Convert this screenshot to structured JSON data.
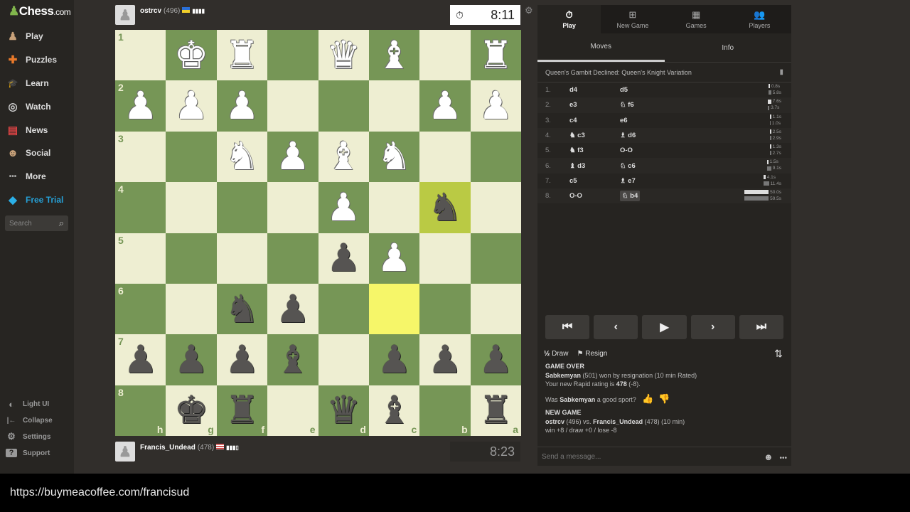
{
  "sidebar": {
    "logo": "Chess",
    "logo_suffix": ".com",
    "items": [
      {
        "label": "Play",
        "icon": "♟"
      },
      {
        "label": "Puzzles",
        "icon": "✚"
      },
      {
        "label": "Learn",
        "icon": "🎓"
      },
      {
        "label": "Watch",
        "icon": "◎"
      },
      {
        "label": "News",
        "icon": "▤"
      },
      {
        "label": "Social",
        "icon": "☻"
      },
      {
        "label": "More",
        "icon": "•••"
      },
      {
        "label": "Free Trial",
        "icon": "◆"
      }
    ],
    "search_placeholder": "Search",
    "bottom": [
      {
        "label": "Light UI",
        "icon": "◐"
      },
      {
        "label": "Collapse",
        "icon": "|←"
      },
      {
        "label": "Settings",
        "icon": "⚙"
      },
      {
        "label": "Support",
        "icon": "?"
      }
    ]
  },
  "top_player": {
    "name": "ostrcv",
    "rating": "(496)",
    "clock": "8:11"
  },
  "bottom_player": {
    "name": "Francis_Undead",
    "rating": "(478)",
    "clock": "8:23"
  },
  "board": {
    "orientation": "black",
    "files": [
      "h",
      "g",
      "f",
      "e",
      "d",
      "c",
      "b",
      "a"
    ],
    "ranks": [
      "1",
      "2",
      "3",
      "4",
      "5",
      "6",
      "7",
      "8"
    ],
    "rows": [
      [
        ".",
        "K",
        "R",
        ".",
        "Q",
        "B",
        ".",
        "R"
      ],
      [
        "P",
        "P",
        "P",
        ".",
        ".",
        ".",
        "P",
        "P"
      ],
      [
        ".",
        ".",
        "N",
        "P",
        "B",
        "N",
        ".",
        "."
      ],
      [
        ".",
        ".",
        ".",
        ".",
        "P",
        ".",
        "n",
        "."
      ],
      [
        ".",
        ".",
        ".",
        ".",
        "p",
        "P",
        ".",
        "."
      ],
      [
        ".",
        ".",
        "n",
        "p",
        ".",
        ".",
        ".",
        "."
      ],
      [
        "p",
        "p",
        "p",
        "b",
        ".",
        "p",
        "p",
        "p"
      ],
      [
        ".",
        "k",
        "r",
        ".",
        "q",
        "b",
        ".",
        "r"
      ]
    ],
    "highlights": {
      "b4": "#baca44",
      "c6": "#f6f669"
    },
    "light": "#eeeed2",
    "dark": "#769656"
  },
  "panel": {
    "tabs": [
      {
        "label": "Play",
        "icon": "⏱"
      },
      {
        "label": "New Game",
        "icon": "⊞"
      },
      {
        "label": "Games",
        "icon": "▦"
      },
      {
        "label": "Players",
        "icon": "👥"
      }
    ],
    "subtabs": [
      "Moves",
      "Info"
    ],
    "opening": "Queen's Gambit Declined: Queen's Knight Variation",
    "moves": [
      {
        "n": "1.",
        "w": "d4",
        "b": "d5",
        "wt": "0.8s",
        "bt": "5.8s"
      },
      {
        "n": "2.",
        "w": "e3",
        "b": "♘ f6",
        "wt": "7.6s",
        "bt": "3.7s"
      },
      {
        "n": "3.",
        "w": "c4",
        "b": "e6",
        "wt": "1.1s",
        "bt": "1.0s"
      },
      {
        "n": "4.",
        "w": "♞ c3",
        "b": "♗ d6",
        "wt": "2.5s",
        "bt": "2.9s"
      },
      {
        "n": "5.",
        "w": "♞ f3",
        "b": "O-O",
        "wt": "1.3s",
        "bt": "2.7s"
      },
      {
        "n": "6.",
        "w": "♝ d3",
        "b": "♘ c6",
        "wt": "1.5s",
        "bt": "9.1s"
      },
      {
        "n": "7.",
        "w": "c5",
        "b": "♗ e7",
        "wt": "4.1s",
        "bt": "11.4s"
      },
      {
        "n": "8.",
        "w": "O-O",
        "b": "♘ b4",
        "wt": "50.0s",
        "bt": "59.5s"
      }
    ],
    "controls": [
      "⏮",
      "‹",
      "▶",
      "›",
      "⏭"
    ],
    "draw": "Draw",
    "draw_icon": "½",
    "resign": "Resign",
    "resign_icon": "⚑",
    "flip_icon": "⇅",
    "chat": {
      "game_over": "GAME OVER",
      "winner": "Sabkemyan",
      "winner_rest": "(501) won by resignation (10 min Rated)",
      "rating_pre": "Your new Rapid rating is",
      "rating_new": "478",
      "rating_delta": "(-8).",
      "sport_pre": "Was",
      "sport_name": "Sabkemyan",
      "sport_post": "a good sport?",
      "new_game": "NEW GAME",
      "p1": "ostrcv",
      "p1_rest": "(496) vs.",
      "p2": "Francis_Undead",
      "p2_rest": "(478) (10 min)",
      "stakes": "win +8 / draw +0 / lose -8"
    },
    "message_placeholder": "Send a message..."
  },
  "footer": {
    "url": "https://buymeacoffee.com/francisud"
  }
}
